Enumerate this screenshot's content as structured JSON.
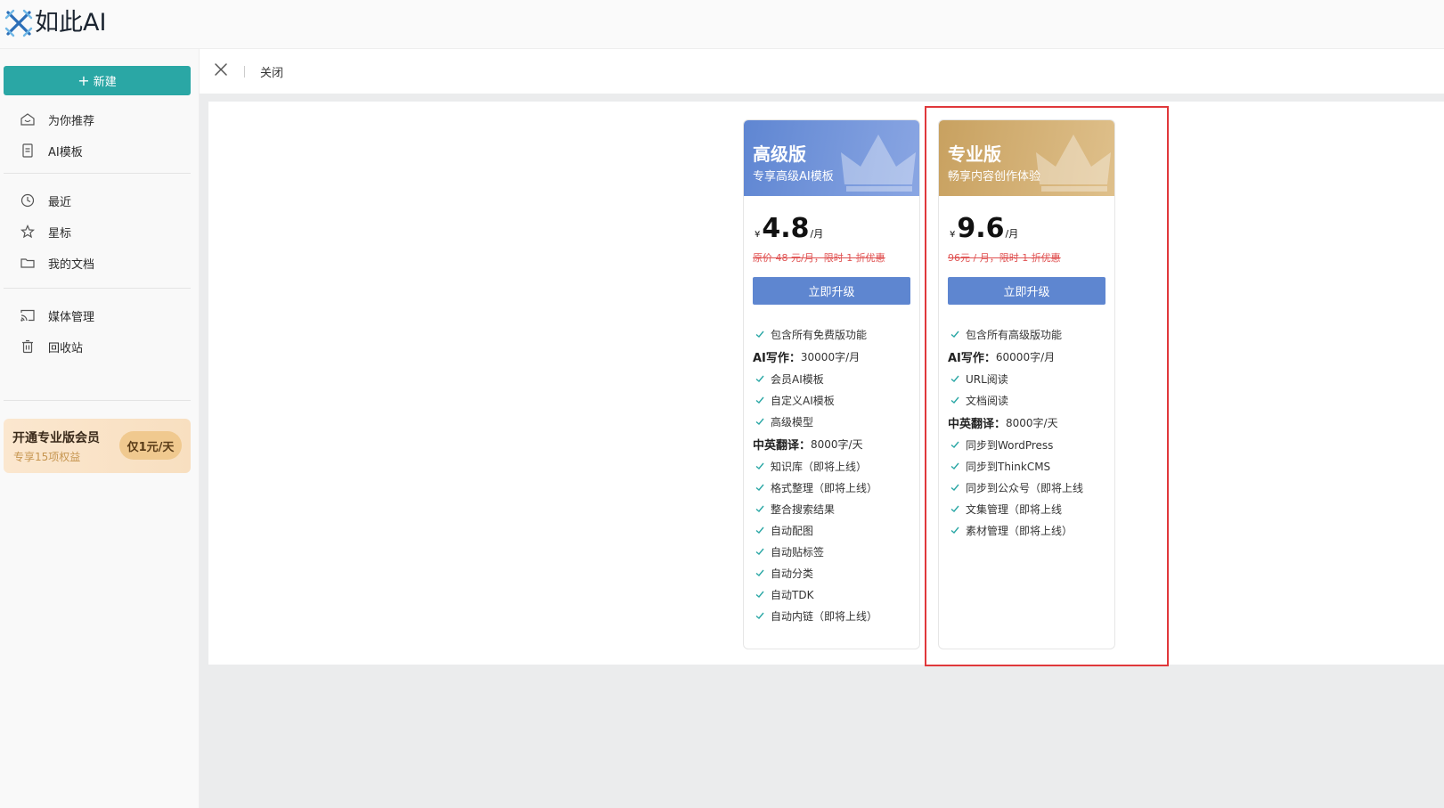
{
  "app": {
    "logo_text": "如此AI"
  },
  "sidebar": {
    "new_label": "新建",
    "items": [
      {
        "label": "为你推荐",
        "icon": "home-icon"
      },
      {
        "label": "AI模板",
        "icon": "document-icon"
      },
      {
        "label": "最近",
        "icon": "clock-icon"
      },
      {
        "label": "星标",
        "icon": "star-icon"
      },
      {
        "label": "我的文档",
        "icon": "folder-icon"
      },
      {
        "label": "媒体管理",
        "icon": "cast-icon"
      },
      {
        "label": "回收站",
        "icon": "trash-icon"
      }
    ],
    "promo": {
      "title": "开通专业版会员",
      "subtitle": "专享15项权益",
      "button": "仅1元/天"
    }
  },
  "closebar": {
    "label": "关闭"
  },
  "plans": [
    {
      "name": "高级版",
      "subtitle": "专享高级AI模板",
      "currency": "¥",
      "price": "4.8",
      "unit": "/月",
      "original": "原价 48 元/月，限时 1 折优惠",
      "button": "立即升级",
      "features": [
        {
          "type": "check",
          "text": "包含所有免费版功能"
        },
        {
          "type": "bold",
          "label": "AI写作：",
          "value": "30000字/月"
        },
        {
          "type": "check",
          "text": "会员AI模板"
        },
        {
          "type": "check",
          "text": "自定义AI模板"
        },
        {
          "type": "check",
          "text": "高级模型"
        },
        {
          "type": "bold",
          "label": "中英翻译：",
          "value": "8000字/天"
        },
        {
          "type": "check",
          "text": "知识库（即将上线）"
        },
        {
          "type": "check",
          "text": "格式整理（即将上线）"
        },
        {
          "type": "check",
          "text": "整合搜索结果"
        },
        {
          "type": "check",
          "text": "自动配图"
        },
        {
          "type": "check",
          "text": "自动贴标签"
        },
        {
          "type": "check",
          "text": "自动分类"
        },
        {
          "type": "check",
          "text": "自动TDK"
        },
        {
          "type": "check",
          "text": "自动内链（即将上线）"
        }
      ],
      "color": "#5e86d0"
    },
    {
      "name": "专业版",
      "subtitle": "畅享内容创作体验",
      "currency": "¥",
      "price": "9.6",
      "unit": "/月",
      "original": "96元 / 月，限时 1 折优惠",
      "button": "立即升级",
      "features": [
        {
          "type": "check",
          "text": "包含所有高级版功能"
        },
        {
          "type": "bold",
          "label": "AI写作：",
          "value": "60000字/月"
        },
        {
          "type": "check",
          "text": "URL阅读"
        },
        {
          "type": "check",
          "text": "文档阅读"
        },
        {
          "type": "bold",
          "label": "中英翻译：",
          "value": "8000字/天"
        },
        {
          "type": "check",
          "text": "同步到WordPress"
        },
        {
          "type": "check",
          "text": "同步到ThinkCMS"
        },
        {
          "type": "check",
          "text": "同步到公众号（即将上线"
        },
        {
          "type": "check",
          "text": "文集管理（即将上线"
        },
        {
          "type": "check",
          "text": "素材管理（即将上线）"
        }
      ],
      "color": "#c8a160"
    }
  ],
  "colors": {
    "accent": "#2aa7a5",
    "highlight": "#e0383b",
    "check": "#2aa7a5"
  }
}
